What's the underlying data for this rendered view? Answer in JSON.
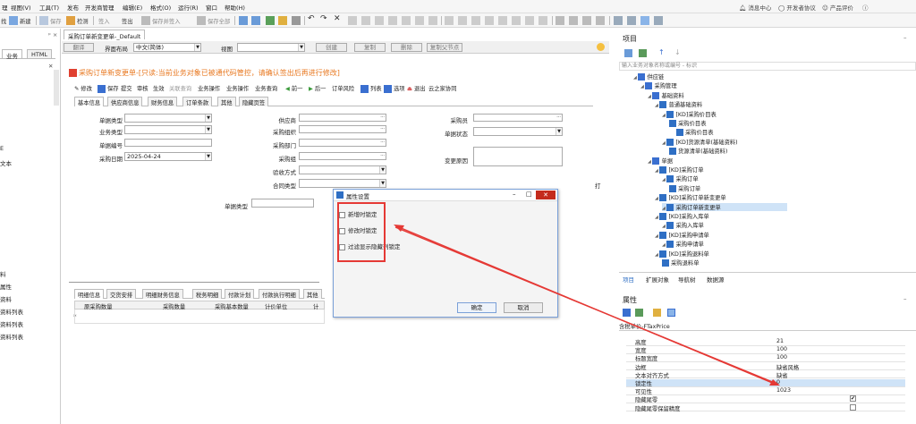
{
  "menubar": {
    "items": [
      "理",
      "视图(V)",
      "工具(T)",
      "发布",
      "开发商管理",
      "编辑(E)",
      "格式(O)",
      "运行(R)",
      "窗口",
      "帮助(H)"
    ],
    "right": [
      "消息中心",
      "开发者协议",
      "产品评价"
    ]
  },
  "toolbar": {
    "items": [
      "找",
      "新建",
      "保存",
      "检测",
      "签入",
      "签出",
      "保存并签入",
      "保存全部"
    ]
  },
  "leftpane": {
    "header_close": "× ",
    "tabs": [
      "业务",
      "HTML"
    ],
    "items": [
      "E",
      "文本",
      "料",
      "属性",
      "资料",
      "资料列表",
      "资料列表",
      "资料列表"
    ]
  },
  "document": {
    "tab_label": "采购订单新变更单-_Default",
    "bar": {
      "translate_btn": "翻译",
      "layout_label": "界面布局",
      "layout_value": "中文(简体)",
      "view_label": "视图",
      "view_value": "",
      "create_btn": "创建",
      "copy_btn": "复制",
      "delete_btn": "删除",
      "copy_child_btn": "复制父节点"
    },
    "form_title": "采购订单新变更单-[只读:当前业务对象已被通代码管控，请确认签出后再进行修改]",
    "actions": [
      "修改",
      "保存",
      "提交",
      "审核",
      "生效",
      "关联查询",
      "业务操作",
      "业务操作",
      "业务查询",
      "前一",
      "后一",
      "订单风险",
      "列表",
      "选项",
      "退出",
      "云之家协同"
    ],
    "form_tabs": [
      "基本信息",
      "供应商信息",
      "财务信息",
      "订单条款",
      "其他",
      "隐藏页签"
    ],
    "fields": {
      "doc_type": "单据类型",
      "biz_type": "业务类型",
      "doc_no": "单据编号",
      "date": "采购日期",
      "date_value": "2025-04-24",
      "supplier": "供应商",
      "purch_org": "采购组织",
      "purch_dept": "采购部门",
      "purch_group": "采购组",
      "check_method": "验收方式",
      "contract_type": "合同类型",
      "buyer": "采购员",
      "doc_status": "单据状态",
      "change_reason": "变更原因",
      "doc_type2": "单据类型",
      "print": "打"
    },
    "bottom_tabs": [
      "明细信息",
      "交货安排",
      "明细财务信息",
      "税务明细",
      "付款计划",
      "付款执行明细",
      "其他"
    ],
    "grid_headers": [
      "原采购数量",
      "采购数量",
      "采购基本数量",
      "计价单位",
      "计"
    ],
    "grid_star": "*"
  },
  "dialog": {
    "title": "属性设置",
    "options": [
      "新增时锁定",
      "修改时锁定",
      "过滤显示隐藏列锁定"
    ],
    "ok": "确定",
    "cancel": "取消"
  },
  "rightpanel": {
    "project_title": "项目",
    "search_placeholder": "输入业务对象名称或编号 - 标识",
    "tree": [
      {
        "label": "供应链",
        "level": 1
      },
      {
        "label": "采购管理",
        "level": 2
      },
      {
        "label": "基础资料",
        "level": 3
      },
      {
        "label": "普通基础资料",
        "level": 4
      },
      {
        "label": "[KD]采购价目表",
        "level": 5
      },
      {
        "label": "采购价目表",
        "level": 6
      },
      {
        "label": "采购价目表",
        "level": 7
      },
      {
        "label": "[KD]货源清单(基础资料)",
        "level": 5
      },
      {
        "label": "货源清单(基础资料)",
        "level": 6
      },
      {
        "label": "单据",
        "level": 3
      },
      {
        "label": "[KD]采购订单",
        "level": 4
      },
      {
        "label": "采购订单",
        "level": 5
      },
      {
        "label": "采购订单",
        "level": 6
      },
      {
        "label": "[KD]采购订单新变更单",
        "level": 4
      },
      {
        "label": "采购订单新变更单",
        "level": 5
      },
      {
        "label": "[KD]采购入库单",
        "level": 4
      },
      {
        "label": "采购入库单",
        "level": 5
      },
      {
        "label": "[KD]采购申请单",
        "level": 4
      },
      {
        "label": "采购申请单",
        "level": 5
      },
      {
        "label": "[KD]采购退料单",
        "level": 4
      },
      {
        "label": "采购退料单",
        "level": 5
      }
    ],
    "bottom_tabs": [
      "项目",
      "扩展对象",
      "导航树",
      "数据源"
    ],
    "props_title": "属性",
    "prop_field": "含税单价-FTaxPrice",
    "props": [
      {
        "name": "高度",
        "value": "21"
      },
      {
        "name": "宽度",
        "value": "100"
      },
      {
        "name": "标题宽度",
        "value": "100"
      },
      {
        "name": "边框",
        "value": "缺省风格"
      },
      {
        "name": "文本对齐方式",
        "value": "缺省"
      },
      {
        "name": "锁定性",
        "value": "0"
      },
      {
        "name": "可见性",
        "value": "1023"
      },
      {
        "name": "隐藏尾零",
        "value": "✔"
      },
      {
        "name": "隐藏尾零保留精度",
        "value": ""
      }
    ]
  },
  "colors": {
    "accent": "#e87820",
    "red": "#e53935",
    "selected": "#cfe3f7",
    "blue": "#2f6fc4"
  }
}
